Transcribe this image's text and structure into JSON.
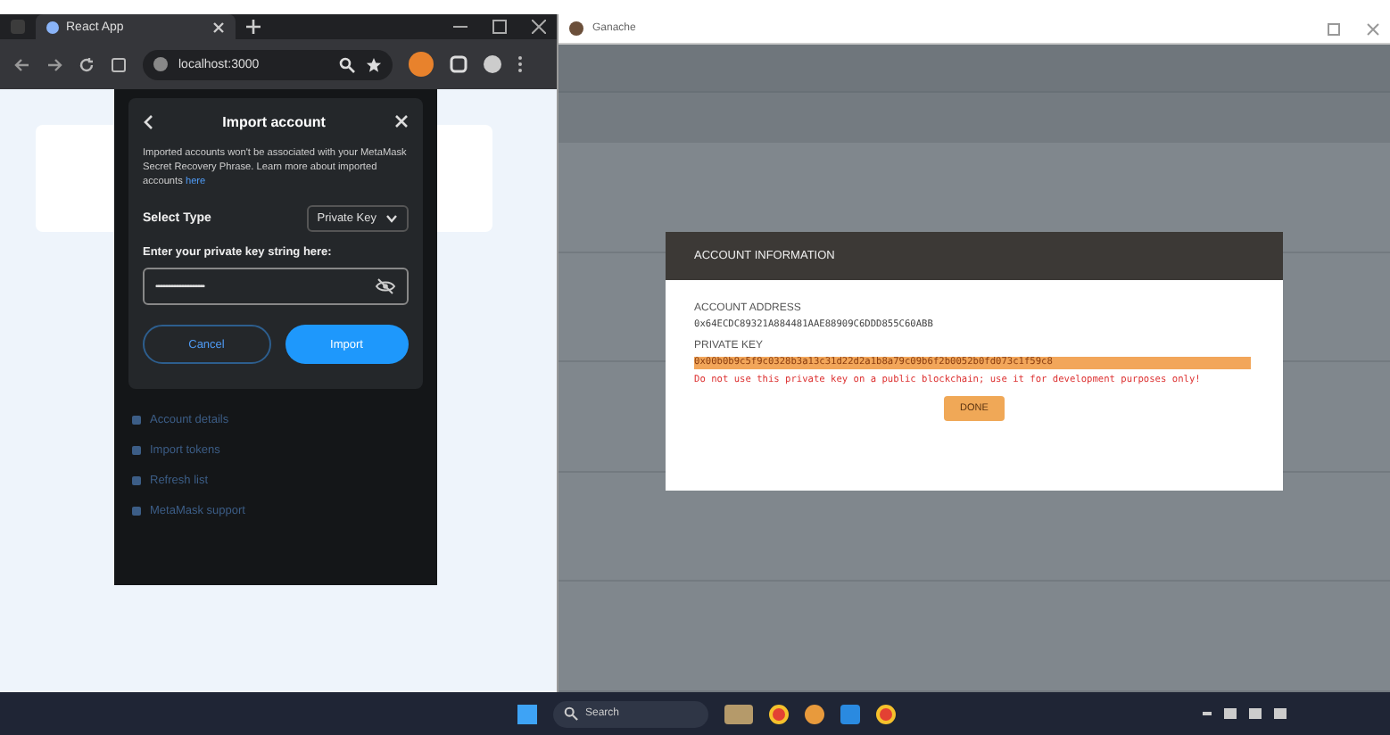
{
  "browser": {
    "tab_title": "React App",
    "url": "localhost:3000"
  },
  "metamask": {
    "dialog_title": "Import account",
    "note": "Imported accounts won't be associated with your MetaMask Secret Recovery Phrase. Learn more about imported accounts ",
    "note_link": "here",
    "select_label": "Select Type",
    "select_value": "Private Key",
    "key_label": "Enter your private key string here:",
    "key_value": "••••••••••••••••••••••••••••••••••••",
    "buttons": [
      {
        "label": "Cancel",
        "kind": "secondary"
      },
      {
        "label": "Import",
        "kind": "primary"
      }
    ],
    "menu": [
      "Account details",
      "Import tokens",
      "Refresh list",
      "MetaMask support"
    ]
  },
  "ganache": {
    "title": "Ganache",
    "modal": {
      "title": "ACCOUNT INFORMATION",
      "address_label": "ACCOUNT ADDRESS",
      "address": "0x64ECDC89321A884481AAE88909C6DDD855C60ABB",
      "key_label": "PRIVATE KEY",
      "private_key": "0x00b0b9c5f9c0328b3a13c31d22d2a1b8a79c09b6f2b0052b0fd073c1f59c8",
      "warning": "Do not use this private key on a public blockchain; use it for development purposes only!",
      "button": "DONE"
    }
  },
  "taskbar": {
    "search_placeholder": "Search"
  }
}
